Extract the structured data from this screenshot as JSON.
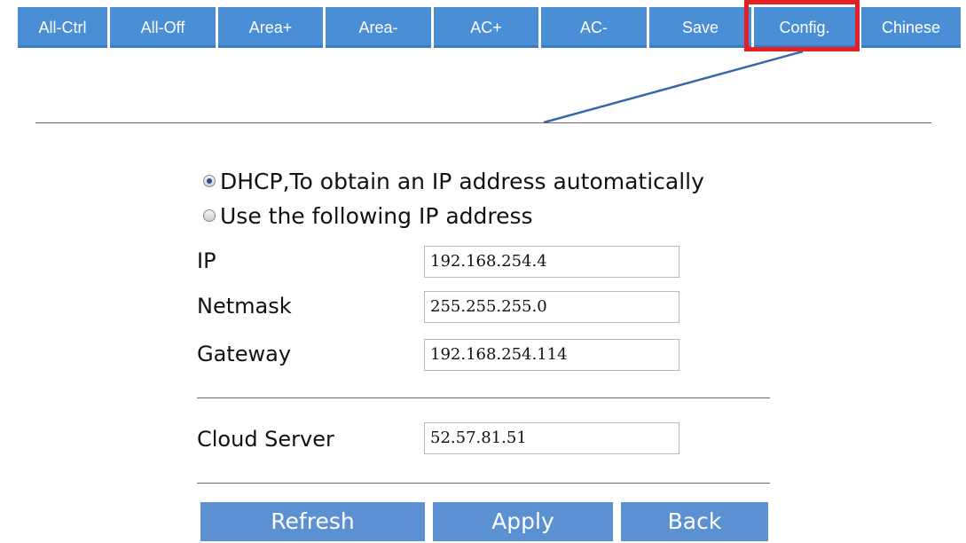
{
  "toolbar": {
    "buttons": [
      {
        "label": "All-Ctrl"
      },
      {
        "label": "All-Off"
      },
      {
        "label": "Area+"
      },
      {
        "label": "Area-"
      },
      {
        "label": "AC+"
      },
      {
        "label": "AC-"
      },
      {
        "label": "Save"
      },
      {
        "label": "Config."
      },
      {
        "label": "Chinese"
      }
    ],
    "highlighted_button": "Config.",
    "highlight_color": "#e41f26",
    "button_color": "#4a8fd6"
  },
  "network": {
    "dhcp_label": "DHCP,To obtain an IP address automatically",
    "static_label": "Use the following IP address",
    "selected_mode": "dhcp",
    "fields": {
      "ip": {
        "label": "IP",
        "value": "192.168.254.4"
      },
      "netmask": {
        "label": "Netmask",
        "value": "255.255.255.0"
      },
      "gateway": {
        "label": "Gateway",
        "value": "192.168.254.114"
      }
    }
  },
  "cloud": {
    "label": "Cloud Server",
    "value": "52.57.81.51"
  },
  "actions": {
    "refresh_label": "Refresh",
    "apply_label": "Apply",
    "back_label": "Back",
    "button_color": "#5b91d3"
  },
  "icons": {
    "radio_checked": "radio-checked-icon",
    "radio_unchecked": "radio-unchecked-icon"
  }
}
